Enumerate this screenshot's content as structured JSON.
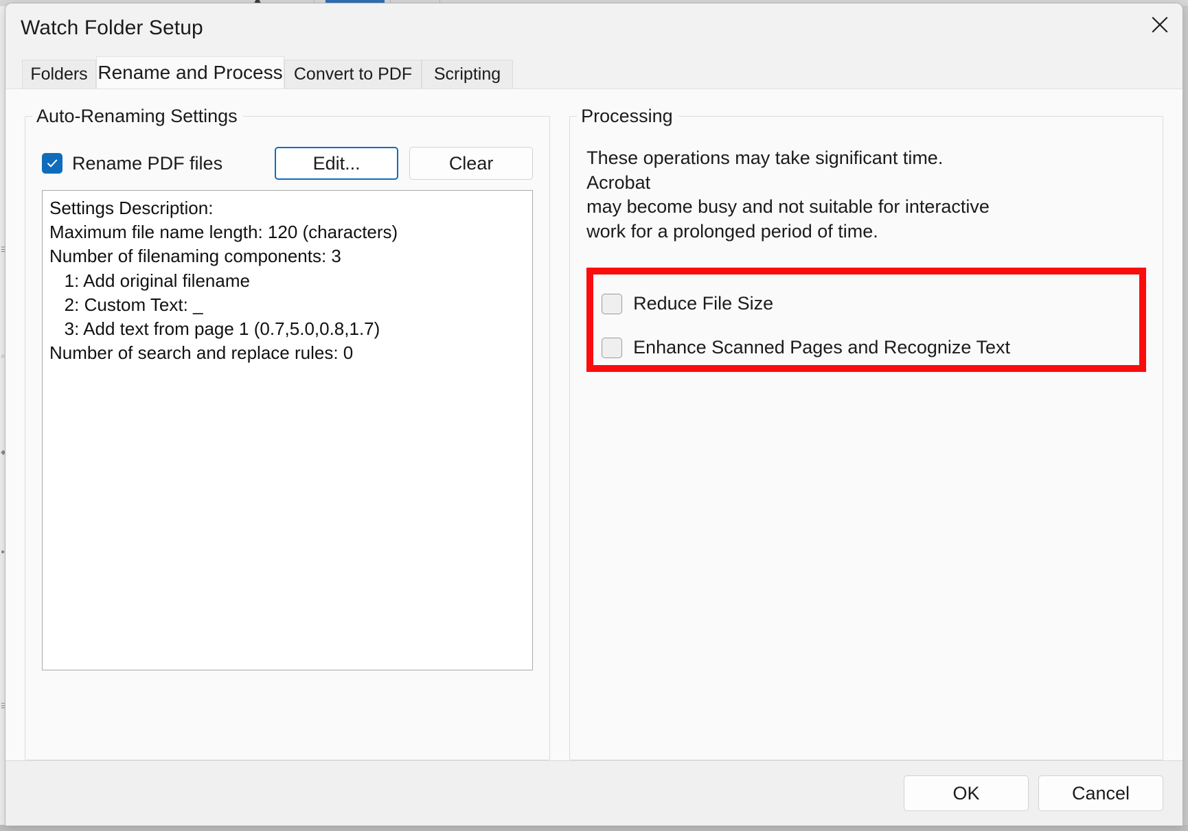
{
  "window": {
    "title": "Watch Folder Setup",
    "close_icon": "close-icon"
  },
  "tabs": [
    {
      "label": "Folders",
      "active": false
    },
    {
      "label": "Rename and Process",
      "active": true
    },
    {
      "label": "Convert to PDF",
      "active": false
    },
    {
      "label": "Scripting",
      "active": false
    }
  ],
  "auto_renaming": {
    "legend": "Auto-Renaming Settings",
    "rename_checkbox": {
      "label": "Rename PDF files",
      "checked": true
    },
    "edit_button": "Edit...",
    "clear_button": "Clear",
    "description_lines": [
      "Settings Description:",
      "Maximum file name length: 120 (characters)",
      "Number of filenaming components: 3",
      "   1: Add original filename",
      "   2: Custom Text: _",
      "   3: Add text from page 1 (0.7,5.0,0.8,1.7)",
      "Number of search and replace rules: 0"
    ]
  },
  "processing": {
    "legend": "Processing",
    "note_line1": "These operations may take significant time. Acrobat",
    "note_line2": "may become busy and not suitable for interactive",
    "note_line3": "work for a prolonged period of time.",
    "highlight_color": "#fc0d0d",
    "options": [
      {
        "label": "Reduce File Size",
        "checked": false
      },
      {
        "label": "Enhance Scanned Pages and Recognize Text",
        "checked": false
      }
    ]
  },
  "footer": {
    "ok_label": "OK",
    "cancel_label": "Cancel"
  },
  "colors": {
    "accent": "#0f6cbd",
    "highlight": "#fc0d0d",
    "dialog_bg": "#fafafa"
  }
}
